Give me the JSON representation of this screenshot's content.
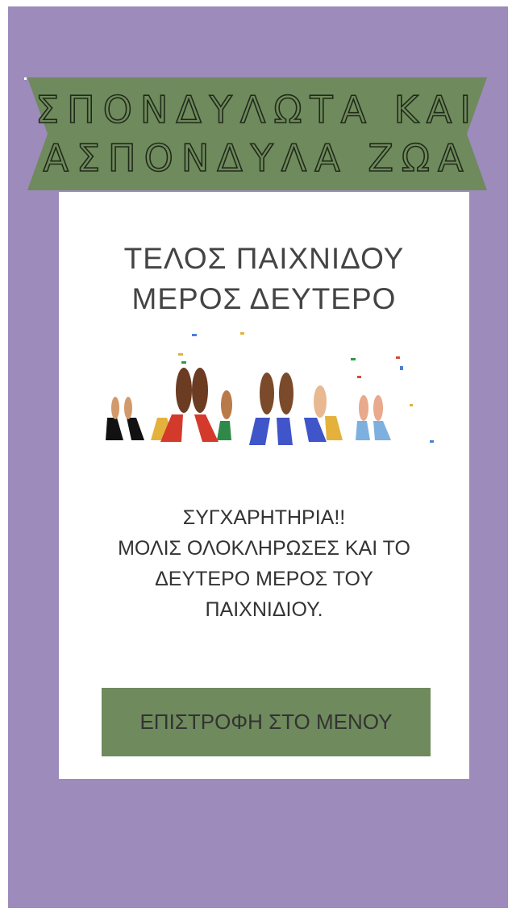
{
  "banner": {
    "line1": "ΣΠΟΝΔΥΛΩΤΑ ΚΑΙ",
    "line2": "ΑΣΠΟΝΔΥΛΑ ΖΩΑ"
  },
  "card": {
    "title_line1": "ΤΕΛΟΣ ΠΑΙΧΝΙΔΟΥ",
    "title_line2": "ΜΕΡΟΣ ΔΕΥΤΕΡΟ",
    "illustration_icon": "clapping-hands-confetti-icon",
    "message_line1": "ΣΥΓΧΑΡΗΤΗΡΙΑ!!",
    "message_line2": "ΜΟΛΙΣ ΟΛΟΚΛΗΡΩΣΕΣ ΚΑΙ ΤΟ",
    "message_line3": "ΔΕΥΤΕΡΟ ΜΕΡΟΣ ΤΟΥ",
    "message_line4": "ΠΑΙΧΝΙΔΙΟΥ.",
    "button_label": "ΕΠΙΣΤΡΟΦΗ ΣΤΟ ΜΕΝΟΥ"
  },
  "colors": {
    "background": "#9c8bbb",
    "accent_green": "#6f8a5d",
    "card": "#ffffff"
  }
}
